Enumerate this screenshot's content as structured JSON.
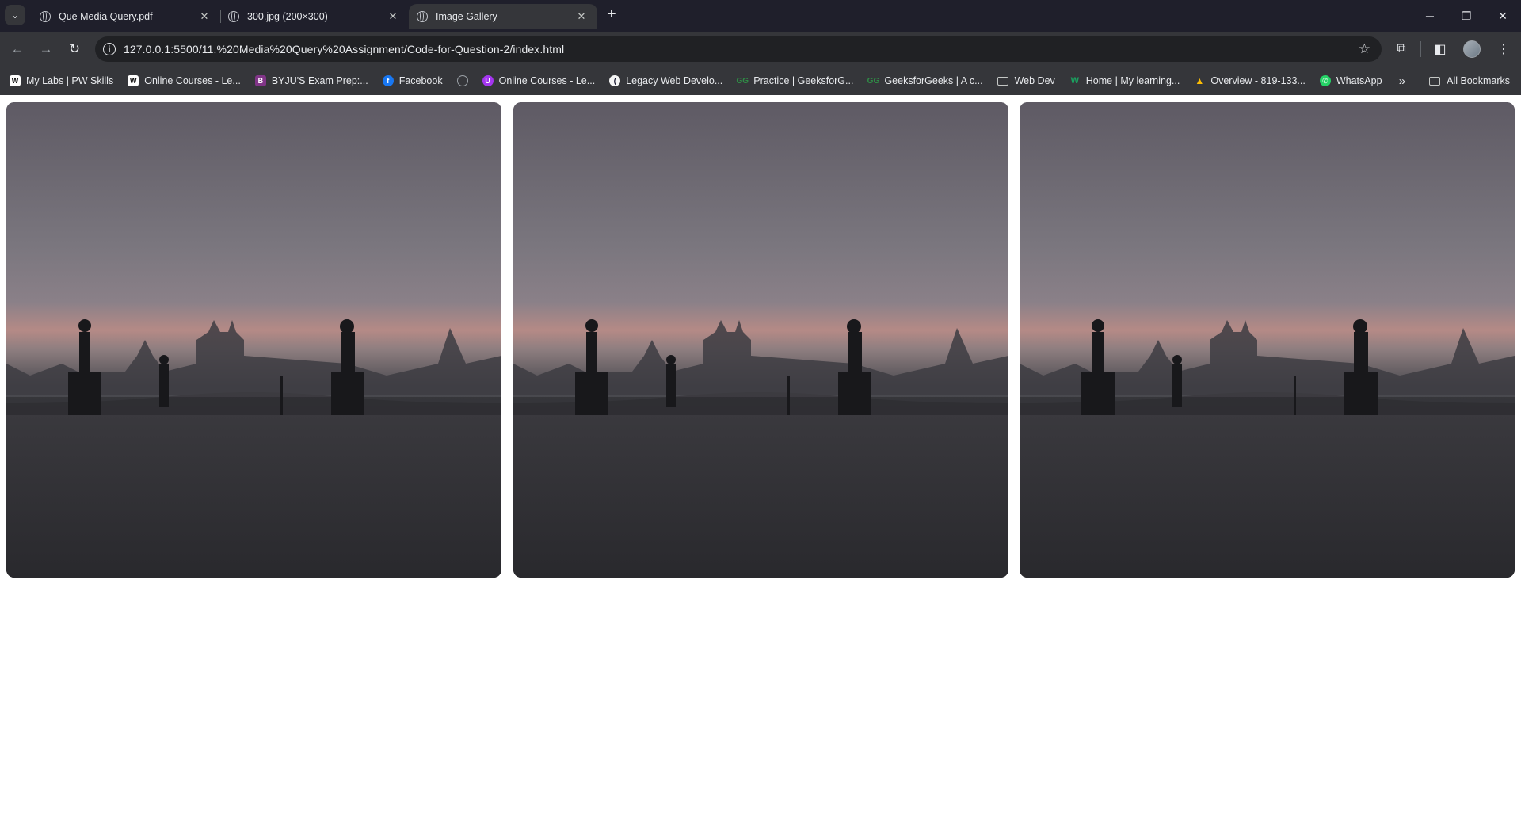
{
  "tabs": [
    {
      "title": "Que Media Query.pdf",
      "active": false
    },
    {
      "title": "300.jpg (200×300)",
      "active": false
    },
    {
      "title": "Image Gallery",
      "active": true
    }
  ],
  "toolbar": {
    "url": "127.0.0.1:5500/11.%20Media%20Query%20Assignment/Code-for-Question-2/index.html"
  },
  "bookmarks": [
    {
      "label": "My Labs | PW Skills",
      "icon": "pw-skills-icon",
      "color": "#ffffff"
    },
    {
      "label": "Online Courses - Le...",
      "icon": "pw-skills-icon",
      "color": "#ffffff"
    },
    {
      "label": "BYJU'S Exam Prep:...",
      "icon": "byjus-icon",
      "color": "#813588"
    },
    {
      "label": "Facebook",
      "icon": "facebook-icon",
      "color": "#1877f2"
    },
    {
      "label": "",
      "icon": "globe-icon",
      "color": "#9aa0a6"
    },
    {
      "label": "Online Courses - Le...",
      "icon": "udemy-icon",
      "color": "#a435f0"
    },
    {
      "label": "Legacy Web Develo...",
      "icon": "freecodecamp-icon",
      "color": "#f5f5f5"
    },
    {
      "label": "Practice | GeeksforG...",
      "icon": "geeksforgeeks-icon",
      "color": "#2f8d46"
    },
    {
      "label": "GeeksforGeeks | A c...",
      "icon": "geeksforgeeks-icon",
      "color": "#2f8d46"
    },
    {
      "label": "Web Dev",
      "icon": "folder-icon",
      "color": "#c4c7c5"
    },
    {
      "label": "Home | My learning...",
      "icon": "wheebox-icon",
      "color": "#1aa260"
    },
    {
      "label": "Overview - 819-133...",
      "icon": "google-ads-icon",
      "color": "#fbbc04"
    },
    {
      "label": "WhatsApp",
      "icon": "whatsapp-icon",
      "color": "#25d366"
    }
  ],
  "all_bookmarks_label": "All Bookmarks",
  "gallery": {
    "images": [
      {
        "alt": "Charles Bridge at dawn"
      },
      {
        "alt": "Charles Bridge at dawn"
      },
      {
        "alt": "Charles Bridge at dawn"
      }
    ]
  },
  "colors": {
    "chrome_dark": "#202124",
    "chrome_toolbar": "#35363a",
    "page_bg": "#ffffff"
  }
}
